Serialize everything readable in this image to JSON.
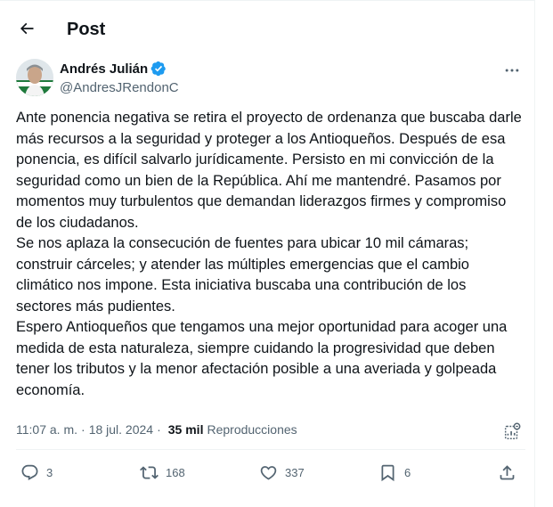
{
  "header": {
    "title": "Post",
    "back_icon": "arrow-left-icon"
  },
  "author": {
    "name": "Andrés Julián",
    "handle": "@AndresJRendonC",
    "verified_color": "#1d9bf0"
  },
  "post": {
    "paragraphs": [
      "Ante ponencia negativa se retira el proyecto de ordenanza que buscaba darle más recursos a la seguridad y proteger a los Antioqueños. Después de esa ponencia, es difícil salvarlo jurídicamente. Persisto en mi convicción de la seguridad como un bien de la República. Ahí me mantendré. Pasamos por momentos muy turbulentos que demandan liderazgos firmes y compromiso de los ciudadanos.",
      "Se nos aplaza la consecución de fuentes para ubicar 10 mil cámaras; construir cárceles; y atender las múltiples emergencias que el cambio climático nos impone. Esta iniciativa buscaba una contribución de los sectores más pudientes.",
      "Espero Antioqueños que tengamos una mejor oportunidad para acoger una medida de esta naturaleza, siempre cuidando la progresividad que deben tener los tributos y la menor afectación posible a una averiada y golpeada economía."
    ],
    "time": "11:07 a. m.",
    "separator": "·",
    "date": "18 jul. 2024",
    "views_count": "35 mil",
    "views_label": "Reproducciones"
  },
  "actions": {
    "replies": "3",
    "reposts": "168",
    "likes": "337",
    "bookmarks": "6"
  }
}
